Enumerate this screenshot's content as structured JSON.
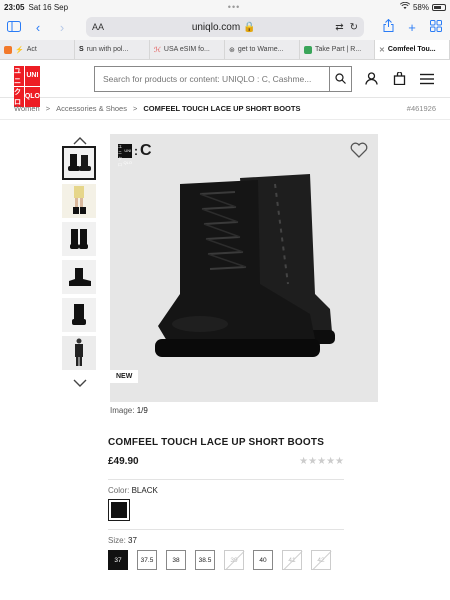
{
  "status": {
    "time": "23:05",
    "date": "Sat 16 Sep",
    "battery": "58%"
  },
  "browser": {
    "aa_label": "AA",
    "url": "uniqlo.com",
    "tabs": [
      {
        "label": "Act",
        "color": "#f2792b"
      },
      {
        "label": "run with pol...",
        "color": "#222222"
      },
      {
        "label": "USA eSIM fo...",
        "color": "#e23b3b"
      },
      {
        "label": "get to Warne...",
        "color": "#333333"
      },
      {
        "label": "Take Part | R...",
        "color": "#3aa55a"
      },
      {
        "label": "Comfeel Tou...",
        "color": "#888888"
      }
    ]
  },
  "header": {
    "logo": [
      "ユニ",
      "UNI",
      "クロ",
      "QLO"
    ],
    "search_placeholder": "Search for products or content: UNIQLO : C, Cashme..."
  },
  "breadcrumb": {
    "items": [
      "Women",
      "Accessories & Shoes",
      "COMFEEL TOUCH LACE UP SHORT BOOTS"
    ],
    "separator": ">",
    "product_id": "#461926"
  },
  "gallery": {
    "new_tag": "NEW",
    "image_label": "Image:",
    "image_count": "1/9",
    "brand_badge": {
      "colon": ":",
      "letter": "C"
    }
  },
  "product": {
    "name": "COMFEEL TOUCH LACE UP SHORT BOOTS",
    "price": "£49.90",
    "stars": "★★★★★",
    "color_label": "Color:",
    "color_value": "BLACK",
    "size_label": "Size:",
    "size_value": "37",
    "sizes": [
      {
        "label": "37",
        "state": "selected"
      },
      {
        "label": "37.5",
        "state": "available"
      },
      {
        "label": "38",
        "state": "available"
      },
      {
        "label": "38.5",
        "state": "available"
      },
      {
        "label": "39",
        "state": "disabled"
      },
      {
        "label": "40",
        "state": "available"
      },
      {
        "label": "41",
        "state": "disabled"
      },
      {
        "label": "42",
        "state": "disabled"
      }
    ]
  }
}
